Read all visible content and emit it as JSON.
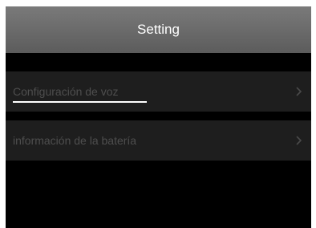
{
  "header": {
    "title": "Setting"
  },
  "menu": {
    "items": [
      {
        "label": "Configuración de voz",
        "icon": "chevron-right-icon",
        "selected": true
      },
      {
        "label": "información de la batería",
        "icon": "chevron-right-icon",
        "selected": false
      }
    ]
  },
  "colors": {
    "background": "#000000",
    "header": "#6b6b6b",
    "row": "#1e1e1e",
    "label": "#4e4e4e",
    "focus_underline": "#ffffff"
  }
}
